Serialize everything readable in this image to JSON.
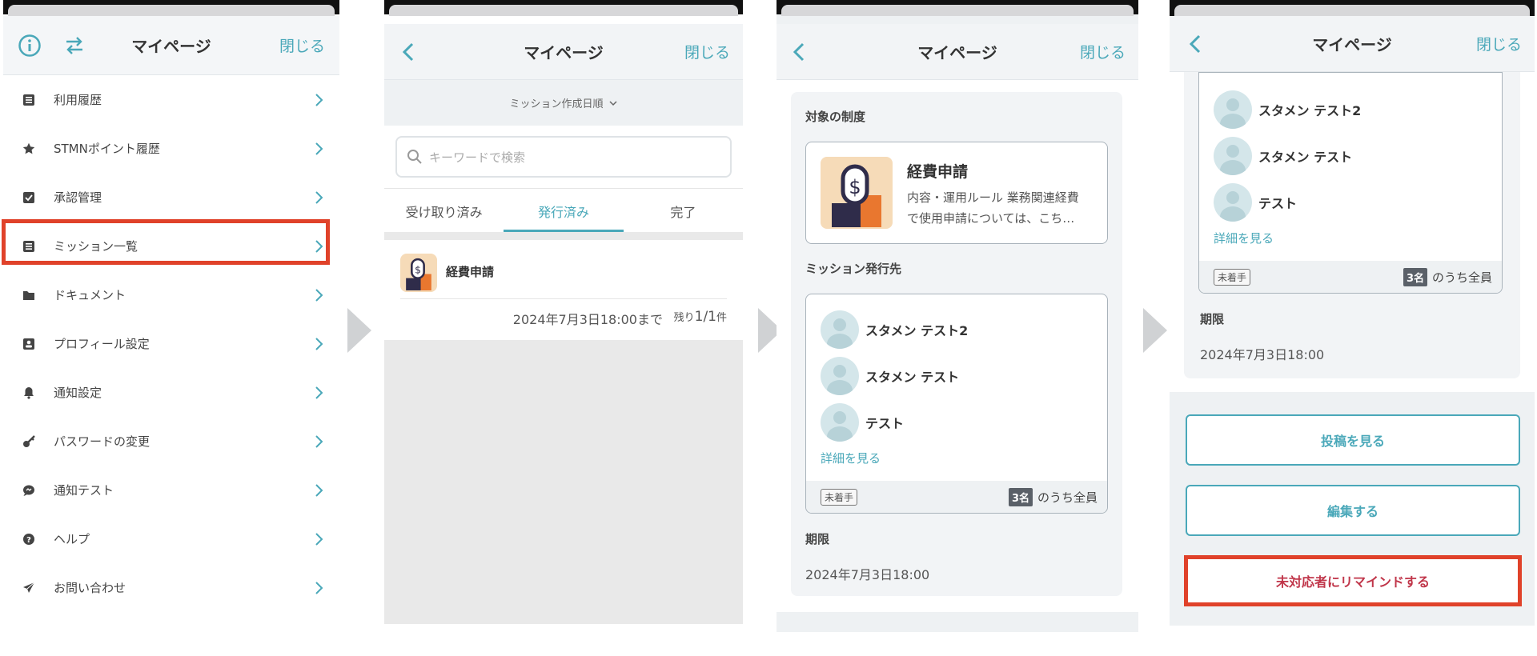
{
  "screen1": {
    "title": "マイページ",
    "close": "閉じる",
    "menu": [
      {
        "label": "利用履歴",
        "icon": "list-icon"
      },
      {
        "label": "STMNポイント履歴",
        "icon": "star-icon"
      },
      {
        "label": "承認管理",
        "icon": "checkbox-icon"
      },
      {
        "label": "ミッション一覧",
        "icon": "list-icon"
      },
      {
        "label": "ドキュメント",
        "icon": "folder-icon"
      },
      {
        "label": "プロフィール設定",
        "icon": "profile-card-icon"
      },
      {
        "label": "通知設定",
        "icon": "bell-icon"
      },
      {
        "label": "パスワードの変更",
        "icon": "key-icon"
      },
      {
        "label": "通知テスト",
        "icon": "chat-bubble-icon"
      },
      {
        "label": "ヘルプ",
        "icon": "question-icon"
      },
      {
        "label": "お問い合わせ",
        "icon": "send-icon"
      }
    ]
  },
  "screen2": {
    "title": "マイページ",
    "close": "閉じる",
    "sort": "ミッション作成日順",
    "search_placeholder": "キーワードで検索",
    "tabs": [
      "受け取り済み",
      "発行済み",
      "完了"
    ],
    "item": {
      "name": "経費申請",
      "deadline": "2024年7月3日18:00まで",
      "remaining_prefix": "残り",
      "remaining_value": "1/1",
      "remaining_suffix": "件"
    }
  },
  "screen3": {
    "title": "マイページ",
    "close": "閉じる",
    "target_title": "対象の制度",
    "system_name": "経費申請",
    "system_desc_1": "内容・運用ルール 業務関連経費",
    "system_desc_2": "で使用申請については、こち…",
    "issued_title": "ミッション発行先",
    "persons": [
      "スタメン テスト2",
      "スタメン テスト",
      "テスト"
    ],
    "details_link": "詳細を見る",
    "status_tag": "未着手",
    "count": "3名",
    "count_suffix": "のうち全員",
    "deadline_title": "期限",
    "deadline": "2024年7月3日18:00"
  },
  "screen4": {
    "title": "マイページ",
    "close": "閉じる",
    "persons": [
      "スタメン テスト2",
      "スタメン テスト",
      "テスト"
    ],
    "details_link": "詳細を見る",
    "status_tag": "未着手",
    "count": "3名",
    "count_suffix": "のうち全員",
    "deadline_title": "期限",
    "deadline": "2024年7月3日18:00",
    "buttons": {
      "view_posts": "投稿を見る",
      "edit": "編集する",
      "remind": "未対応者にリマインドする"
    }
  },
  "colors": {
    "accent": "#4aa8b9",
    "highlight": "#e0422a",
    "remind_text": "#c0364a"
  }
}
